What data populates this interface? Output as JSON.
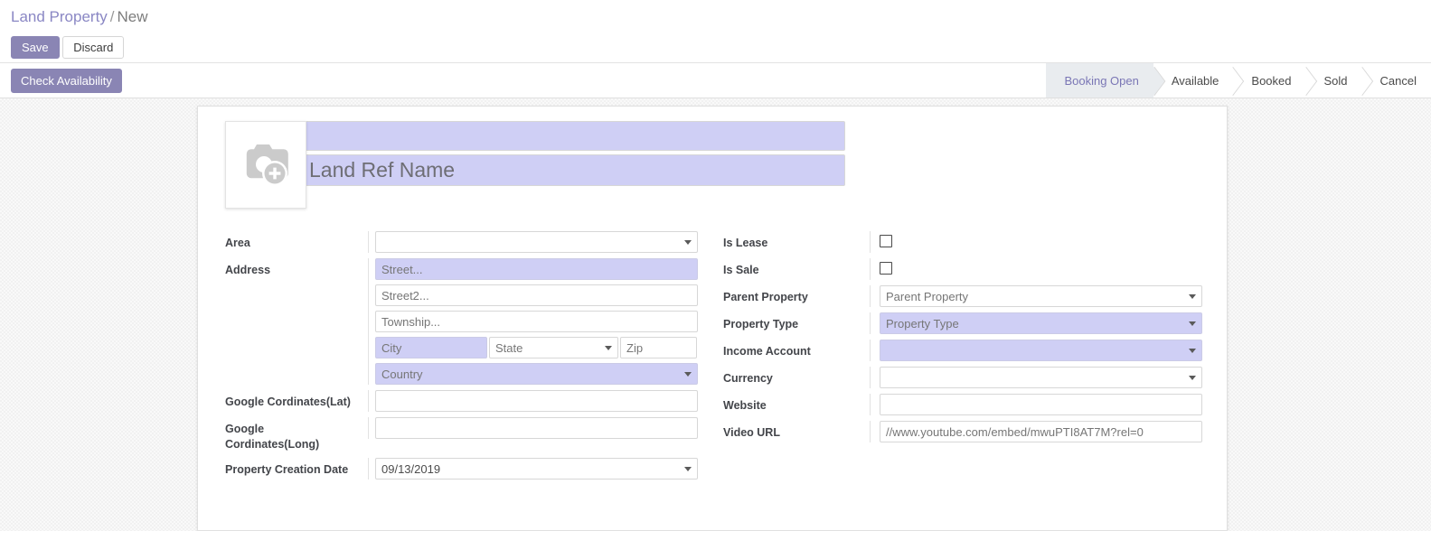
{
  "breadcrumb": {
    "root": "Land Property",
    "separator": "/",
    "current": "New"
  },
  "toolbar": {
    "save_label": "Save",
    "discard_label": "Discard"
  },
  "control_panel": {
    "check_availability_label": "Check Availability"
  },
  "statusbar": {
    "stages": [
      {
        "label": "Booking Open",
        "active": true
      },
      {
        "label": "Available",
        "active": false
      },
      {
        "label": "Booked",
        "active": false
      },
      {
        "label": "Sold",
        "active": false
      },
      {
        "label": "Cancel",
        "active": false
      }
    ]
  },
  "record": {
    "image_placeholder_icon": "camera-plus-icon",
    "title_top": {
      "value": "",
      "placeholder": ""
    },
    "title_main": {
      "value": "",
      "placeholder": "Land Ref Name"
    }
  },
  "form": {
    "left": {
      "area": {
        "label": "Area",
        "value": "",
        "placeholder": "",
        "required": false,
        "type": "select"
      },
      "address": {
        "label": "Address",
        "street": {
          "value": "",
          "placeholder": "Street...",
          "required": true
        },
        "street2": {
          "value": "",
          "placeholder": "Street2...",
          "required": false
        },
        "township": {
          "value": "",
          "placeholder": "Township...",
          "required": false
        },
        "city": {
          "value": "",
          "placeholder": "City",
          "required": true
        },
        "state": {
          "value": "",
          "placeholder": "State",
          "required": false,
          "type": "select"
        },
        "zip": {
          "value": "",
          "placeholder": "Zip",
          "required": false
        },
        "country": {
          "value": "",
          "placeholder": "Country",
          "required": true,
          "type": "select"
        }
      },
      "lat": {
        "label": "Google Cordinates(Lat)",
        "value": "",
        "placeholder": "",
        "required": false
      },
      "long": {
        "label": "Google Cordinates(Long)",
        "value": "",
        "placeholder": "",
        "required": false
      },
      "creation_date": {
        "label": "Property Creation Date",
        "value": "09/13/2019",
        "placeholder": "",
        "required": false,
        "type": "date"
      }
    },
    "right": {
      "is_lease": {
        "label": "Is Lease",
        "checked": false
      },
      "is_sale": {
        "label": "Is Sale",
        "checked": false
      },
      "parent_property": {
        "label": "Parent Property",
        "value": "",
        "placeholder": "Parent Property",
        "required": false,
        "type": "select"
      },
      "property_type": {
        "label": "Property Type",
        "value": "",
        "placeholder": "Property Type",
        "required": true,
        "type": "select"
      },
      "income_account": {
        "label": "Income Account",
        "value": "",
        "placeholder": "",
        "required": true,
        "type": "select"
      },
      "currency": {
        "label": "Currency",
        "value": "",
        "placeholder": "",
        "required": false,
        "type": "select"
      },
      "website": {
        "label": "Website",
        "value": "",
        "placeholder": "",
        "required": false
      },
      "video_url": {
        "label": "Video URL",
        "value": "",
        "placeholder": "//www.youtube.com/embed/mwuPTI8AT7M?rel=0",
        "required": false
      }
    }
  },
  "colors": {
    "primary_purple": "#8a85b4",
    "required_field": "#cfcff5",
    "link": "#8a87c4",
    "active_stage_bg": "#e9ecef",
    "active_stage_text": "#7a76b5"
  }
}
